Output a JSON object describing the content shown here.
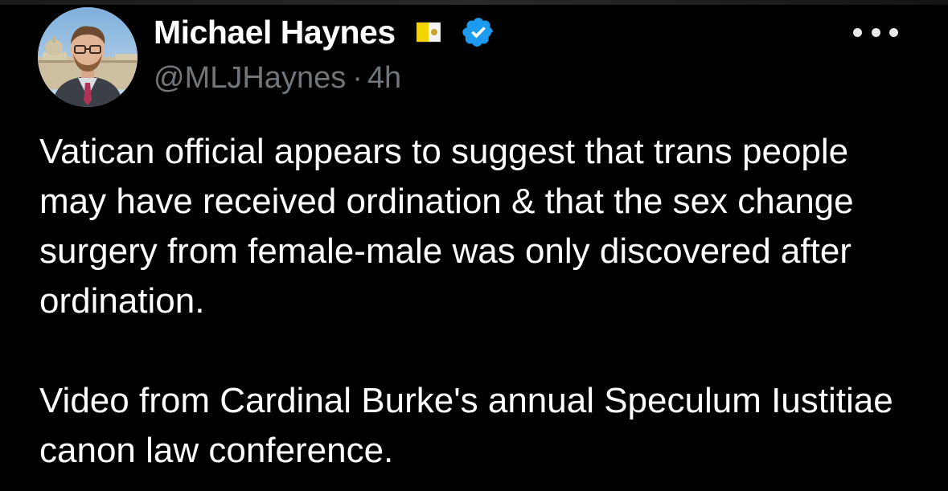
{
  "author": {
    "display_name": "Michael Haynes",
    "handle": "@MLJHaynes",
    "separator": "·",
    "timestamp": "4h",
    "flag_icon": "vatican-flag-icon",
    "verified_icon": "verified-badge-icon",
    "verified_color": "#1d9bf0"
  },
  "menu": {
    "icon": "more-options-icon"
  },
  "tweet": {
    "paragraph_1": "Vatican official appears to suggest that trans people may have received ordination & that the sex change surgery from female-male was only discovered after ordination.",
    "paragraph_2": "Video from Cardinal Burke's annual Speculum Iustitiae canon law conference."
  },
  "colors": {
    "background": "#000000",
    "text": "#ffffff",
    "secondary_text": "#71767b",
    "accent": "#1d9bf0"
  }
}
